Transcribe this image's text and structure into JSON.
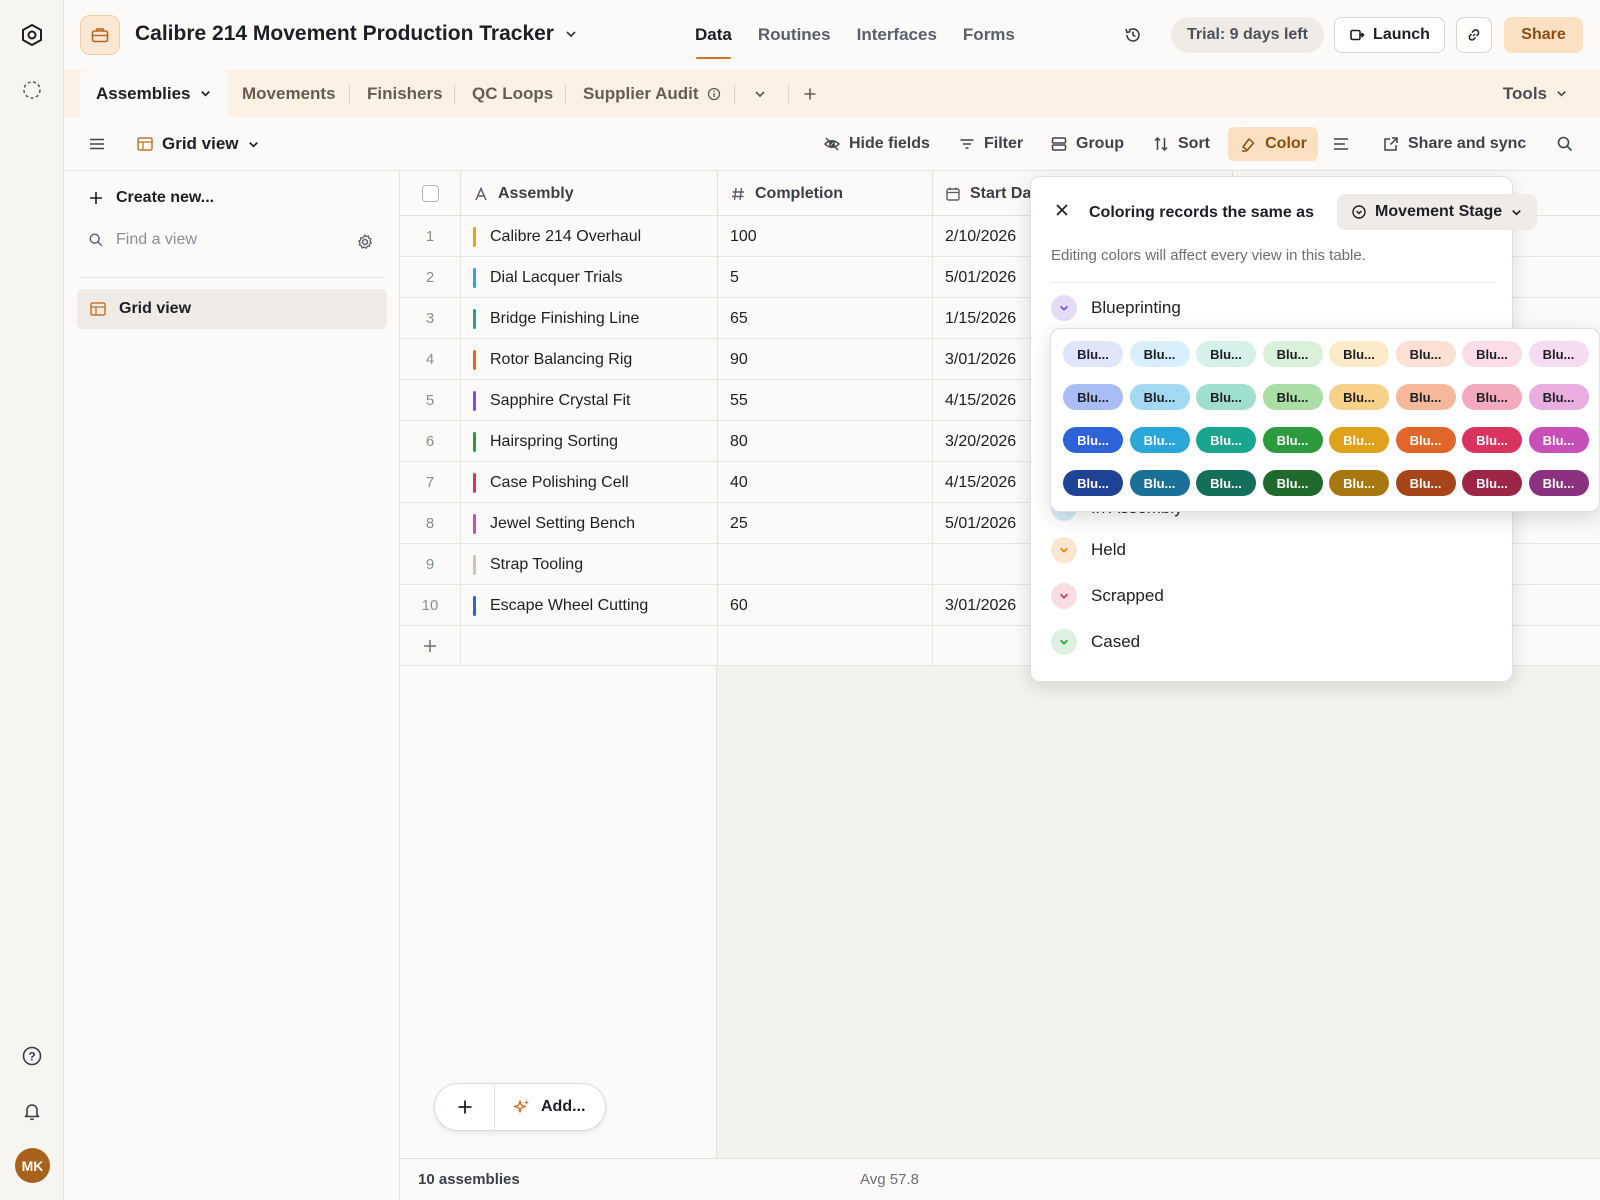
{
  "app": {
    "base_title": "Calibre 214 Movement Production Tracker",
    "nav_tabs": [
      "Data",
      "Routines",
      "Interfaces",
      "Forms"
    ],
    "active_nav": "Data",
    "trial_label": "Trial: 9 days left",
    "launch_label": "Launch",
    "share_label": "Share",
    "user_initials": "MK"
  },
  "tables": {
    "active": "Assemblies",
    "others": [
      "Movements",
      "Finishers",
      "QC Loops",
      "Supplier Audit"
    ],
    "tools_label": "Tools"
  },
  "viewbar": {
    "view_name": "Grid view",
    "hide_fields": "Hide fields",
    "filter": "Filter",
    "group": "Group",
    "sort": "Sort",
    "color": "Color",
    "share_sync": "Share and sync"
  },
  "sidebar": {
    "create_new": "Create new...",
    "find_placeholder": "Find a view",
    "views": [
      "Grid view"
    ]
  },
  "grid": {
    "columns": [
      "Assembly",
      "Completion",
      "Start Da"
    ],
    "rows": [
      {
        "n": "1",
        "assembly": "Calibre 214 Overhaul",
        "completion": "100",
        "start": "2/10/2026",
        "color": "#e8a21a"
      },
      {
        "n": "2",
        "assembly": "Dial Lacquer Trials",
        "completion": "5",
        "start": "5/01/2026",
        "color": "#2aa7d8"
      },
      {
        "n": "3",
        "assembly": "Bridge Finishing Line",
        "completion": "65",
        "start": "1/15/2026",
        "color": "#1aa58e"
      },
      {
        "n": "4",
        "assembly": "Rotor Balancing Rig",
        "completion": "90",
        "start": "3/01/2026",
        "color": "#e0662a"
      },
      {
        "n": "5",
        "assembly": "Sapphire Crystal Fit",
        "completion": "55",
        "start": "4/15/2026",
        "color": "#7b4fd6"
      },
      {
        "n": "6",
        "assembly": "Hairspring Sorting",
        "completion": "80",
        "start": "3/20/2026",
        "color": "#2e9a3e"
      },
      {
        "n": "7",
        "assembly": "Case Polishing Cell",
        "completion": "40",
        "start": "4/15/2026",
        "color": "#d8345f"
      },
      {
        "n": "8",
        "assembly": "Jewel Setting Bench",
        "completion": "25",
        "start": "5/01/2026",
        "color": "#c94fb8"
      },
      {
        "n": "9",
        "assembly": "Strap Tooling",
        "completion": "",
        "start": "",
        "color": "#c9c6c0"
      },
      {
        "n": "10",
        "assembly": "Escape Wheel Cutting",
        "completion": "60",
        "start": "3/01/2026",
        "color": "#2d62d8"
      }
    ],
    "footer_count": "10 assemblies",
    "footer_avg": "Avg 57.8",
    "add_label": "Add..."
  },
  "color_popover": {
    "title": "Coloring records the same as",
    "field": "Movement Stage",
    "description": "Editing colors will affect every view in this table.",
    "options": [
      {
        "label": "Blueprinting",
        "color": "#e6dcf8",
        "arrow": "#7b4fd6"
      },
      {
        "label": "In Assembly",
        "color": "#d9ecf7",
        "arrow": "#2aa7d8"
      },
      {
        "label": "Held",
        "color": "#fbe6cf",
        "arrow": "#d98a1a"
      },
      {
        "label": "Scrapped",
        "color": "#fadde3",
        "arrow": "#d8345f"
      },
      {
        "label": "Cased",
        "color": "#dcf1e0",
        "arrow": "#2e9a3e"
      }
    ]
  },
  "palette": {
    "chip_label": "Blu...",
    "rows": [
      [
        {
          "bg": "#dfe6fb",
          "fg": "#1d1f25"
        },
        {
          "bg": "#d8eefb",
          "fg": "#1d1f25"
        },
        {
          "bg": "#d5f1ea",
          "fg": "#1d1f25"
        },
        {
          "bg": "#d9f1d9",
          "fg": "#1d1f25"
        },
        {
          "bg": "#fbebc9",
          "fg": "#1d1f25"
        },
        {
          "bg": "#fbe0d3",
          "fg": "#1d1f25"
        },
        {
          "bg": "#fadde6",
          "fg": "#1d1f25"
        },
        {
          "bg": "#f6dcf2",
          "fg": "#1d1f25"
        }
      ],
      [
        {
          "bg": "#a9bdf4",
          "fg": "#1d1f25"
        },
        {
          "bg": "#a3d8f2",
          "fg": "#1d1f25"
        },
        {
          "bg": "#9edfcd",
          "fg": "#1d1f25"
        },
        {
          "bg": "#a9dea5",
          "fg": "#1d1f25"
        },
        {
          "bg": "#f8d188",
          "fg": "#1d1f25"
        },
        {
          "bg": "#f6b89a",
          "fg": "#1d1f25"
        },
        {
          "bg": "#f3a9be",
          "fg": "#1d1f25"
        },
        {
          "bg": "#eaaddf",
          "fg": "#1d1f25"
        }
      ],
      [
        {
          "bg": "#2d62d8",
          "fg": "#ffffff"
        },
        {
          "bg": "#2aa7d8",
          "fg": "#ffffff"
        },
        {
          "bg": "#1aa58e",
          "fg": "#ffffff"
        },
        {
          "bg": "#2e9a3e",
          "fg": "#ffffff"
        },
        {
          "bg": "#e0a21a",
          "fg": "#ffffff"
        },
        {
          "bg": "#e0662a",
          "fg": "#ffffff"
        },
        {
          "bg": "#d8345f",
          "fg": "#ffffff"
        },
        {
          "bg": "#c94fb8",
          "fg": "#ffffff"
        }
      ],
      [
        {
          "bg": "#1f4496",
          "fg": "#ffffff"
        },
        {
          "bg": "#1a7096",
          "fg": "#ffffff"
        },
        {
          "bg": "#146e5c",
          "fg": "#ffffff"
        },
        {
          "bg": "#1f6a2b",
          "fg": "#ffffff"
        },
        {
          "bg": "#a87710",
          "fg": "#ffffff"
        },
        {
          "bg": "#a7451a",
          "fg": "#ffffff"
        },
        {
          "bg": "#9c2444",
          "fg": "#ffffff"
        },
        {
          "bg": "#8a3180",
          "fg": "#ffffff"
        }
      ]
    ]
  }
}
